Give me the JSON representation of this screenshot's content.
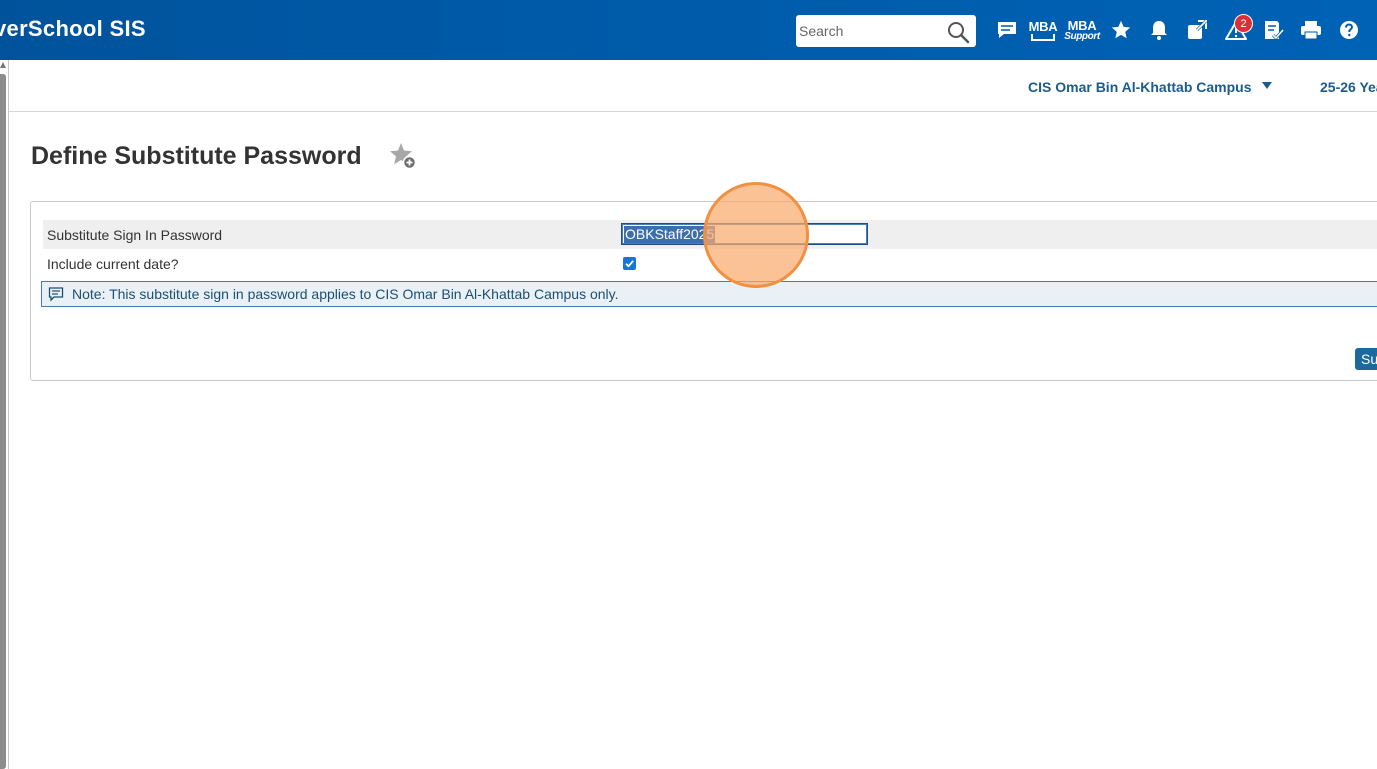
{
  "app": {
    "brand": "verSchool SIS"
  },
  "header": {
    "search_placeholder": "Search",
    "mba_label": "MBA",
    "mba_support_label": "MBA",
    "mba_support_sub": "Support",
    "alerts_count": "2",
    "icons": [
      "messages-icon",
      "mba-icon",
      "mba-support-icon",
      "star-icon",
      "bell-icon",
      "external-link-icon",
      "alert-icon",
      "checklist-icon",
      "print-icon",
      "help-icon"
    ]
  },
  "subheader": {
    "school": "CIS Omar Bin Al-Khattab Campus",
    "term": "25-26 Yea"
  },
  "page": {
    "title": "Define Substitute Password"
  },
  "form": {
    "password_label": "Substitute Sign In Password",
    "password_value": "OBKStaff2025",
    "include_date_label": "Include current date?",
    "include_date_checked": true,
    "note": "Note: This substitute sign in password applies to CIS Omar Bin Al-Khattab Campus only.",
    "submit_label": "Su"
  },
  "colors": {
    "header_bg": "#005aa8",
    "link_blue": "#1a5c8e",
    "button_bg": "#1b6a9e",
    "click_indicator": "#f09040"
  }
}
